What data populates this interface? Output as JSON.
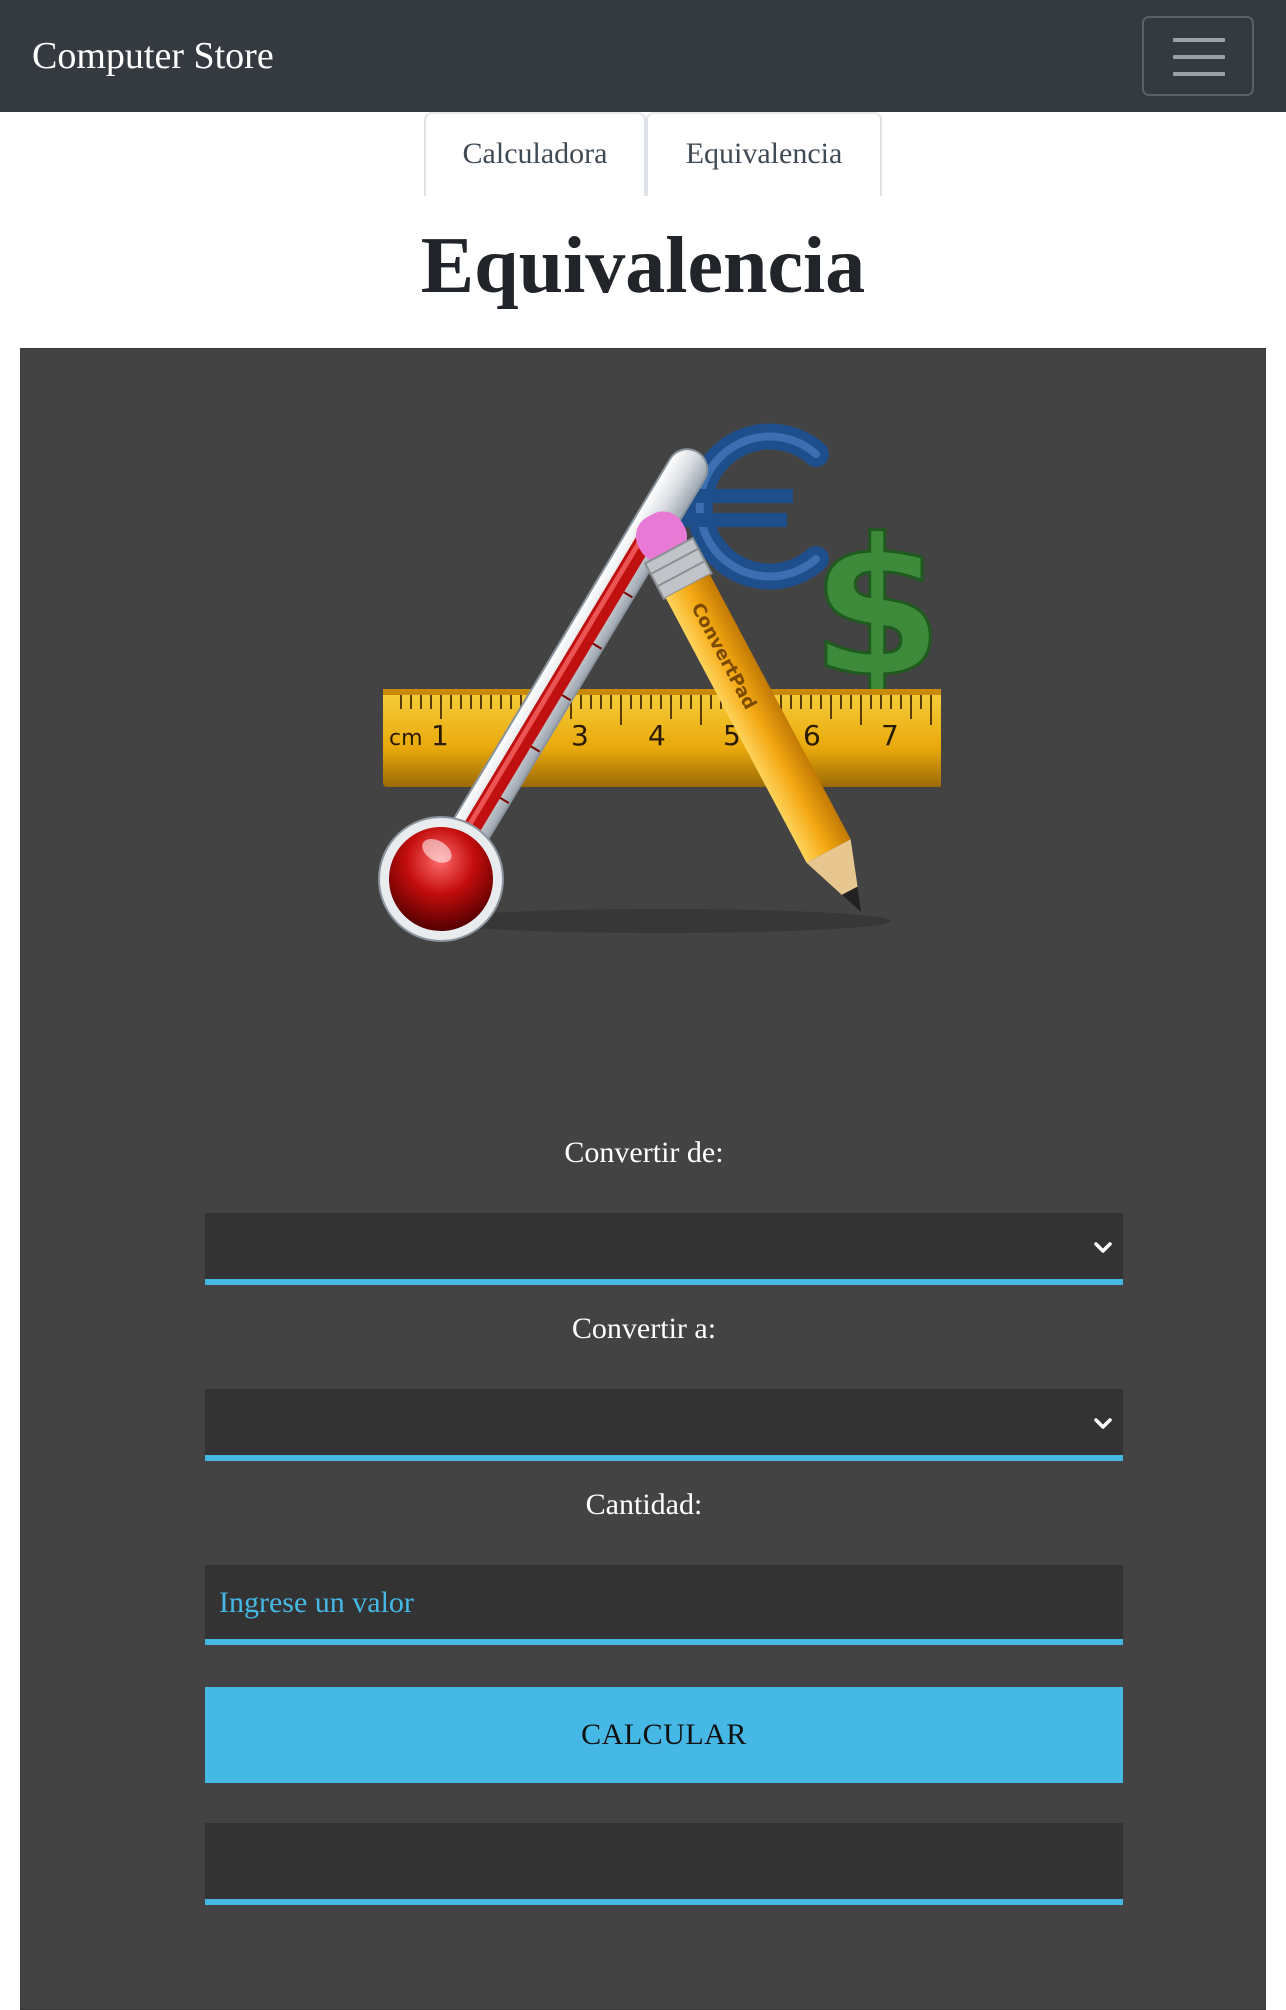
{
  "navbar": {
    "brand": "Computer Store",
    "toggler_icon": "hamburger-menu-icon"
  },
  "tabs": [
    {
      "label": "Calculadora"
    },
    {
      "label": "Equivalencia"
    }
  ],
  "page": {
    "title": "Equivalencia"
  },
  "logo": {
    "icon": "convertpad-logo",
    "pencil_text": "ConvertPad",
    "ruler_unit": "cm",
    "ruler_numbers": [
      "1",
      "3",
      "4",
      "5",
      "6",
      "7"
    ]
  },
  "form": {
    "from_label": "Convertir de:",
    "from_value": "",
    "to_label": "Convertir a:",
    "to_value": "",
    "amount_label": "Cantidad:",
    "amount_placeholder": "Ingrese un valor",
    "calculate_label": "CALCULAR",
    "result_value": ""
  },
  "colors": {
    "navbar_bg": "#343a40",
    "panel_bg": "#434343",
    "field_bg": "#333333",
    "accent": "#45b8e6"
  }
}
